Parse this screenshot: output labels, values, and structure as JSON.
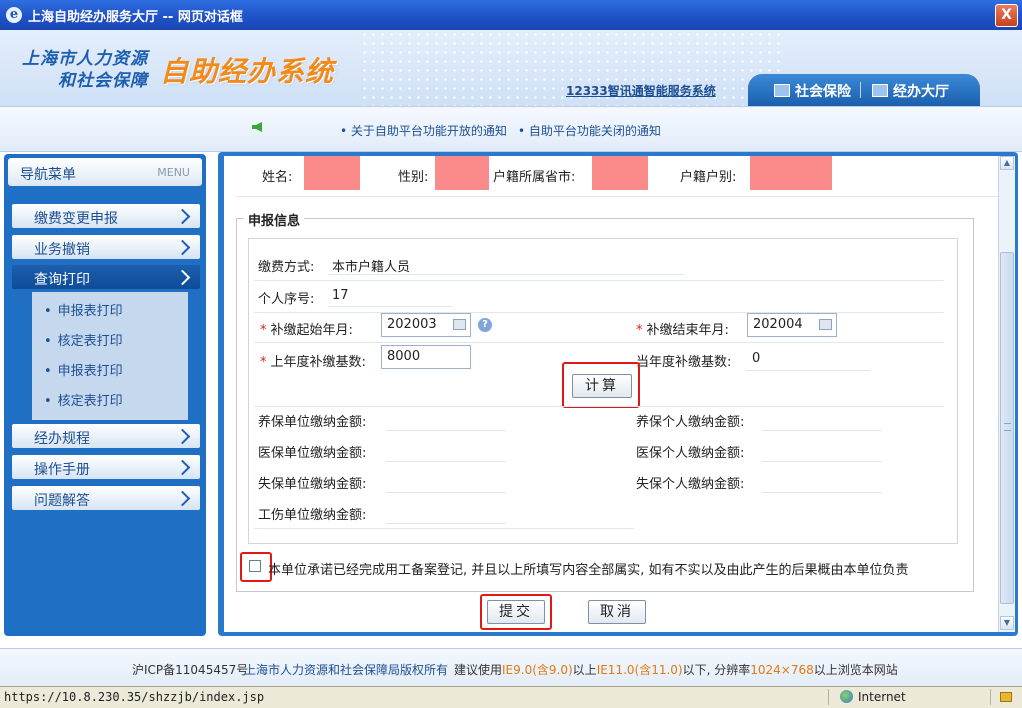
{
  "window": {
    "title": "上海自助经办服务大厅 -- 网页对话框",
    "close_glyph": "X",
    "ie_glyph": "e"
  },
  "header": {
    "org_line1": "上海市人力资源",
    "org_line2": "和社会保障",
    "system_name": "自助经办系统",
    "link_12333": "12333智讯通智能服务系统",
    "tabs": [
      "社会保险",
      "经办大厅"
    ]
  },
  "notices": [
    "• 关于自助平台功能开放的通知",
    "• 自助平台功能关闭的通知"
  ],
  "sidebar": {
    "title": "导航菜单",
    "title_en": "MENU",
    "items": [
      {
        "label": "缴费变更申报"
      },
      {
        "label": "业务撤销"
      },
      {
        "label": "查询打印",
        "active": true
      },
      {
        "label": "经办规程"
      },
      {
        "label": "操作手册"
      },
      {
        "label": "问题解答"
      }
    ],
    "subitems": [
      "申报表打印",
      "核定表打印",
      "申报表打印",
      "核定表打印"
    ]
  },
  "person": {
    "labels": [
      "姓名:",
      "性别:",
      "户籍所属省市:",
      "户籍户别:"
    ]
  },
  "form": {
    "section_title": "申报信息",
    "payment_method_label": "缴费方式:",
    "payment_method_value": "本市户籍人员",
    "seq_label": "个人序号:",
    "seq_value": "17",
    "start_label": "补缴起始年月:",
    "start_value": "202003",
    "end_label": "补缴结束年月:",
    "end_value": "202004",
    "prev_base_label": "上年度补缴基数:",
    "prev_base_value": "8000",
    "cur_base_label": "当年度补缴基数:",
    "cur_base_value": "0",
    "help_glyph": "?",
    "required_mark": "*",
    "calc_button": "计算",
    "amounts_left": [
      "养保单位缴纳金额:",
      "医保单位缴纳金额:",
      "失保单位缴纳金额:",
      "工伤单位缴纳金额:"
    ],
    "amounts_right": [
      "养保个人缴纳金额:",
      "医保个人缴纳金额:",
      "失保个人缴纳金额:"
    ],
    "commitment_text": "本单位承诺已经完成用工备案登记, 并且以上所填写内容全部属实, 如有不实以及由此产生的后果概由本单位负责",
    "submit_button": "提交",
    "cancel_button": "取消"
  },
  "footer": {
    "icp": "沪ICP备11045457号",
    "copyright": "上海市人力资源和社会保障局版权所有",
    "suggest_prefix": "建议使用",
    "ie9": "IE9.0(含9.0)",
    "mid1": "以上",
    "ie11": "IE11.0(含11.0)",
    "mid2": "以下, 分辨率",
    "res": "1024×768",
    "suffix": "以上浏览本网站"
  },
  "status": {
    "url": "https://10.8.230.35/shzzjb/index.jsp",
    "zone": "Internet"
  },
  "colors": {
    "accent": "#1f6fc4",
    "highlight_box": "#e01818",
    "redacted": "#fb8a8a",
    "system_name": "#f28a1a"
  }
}
